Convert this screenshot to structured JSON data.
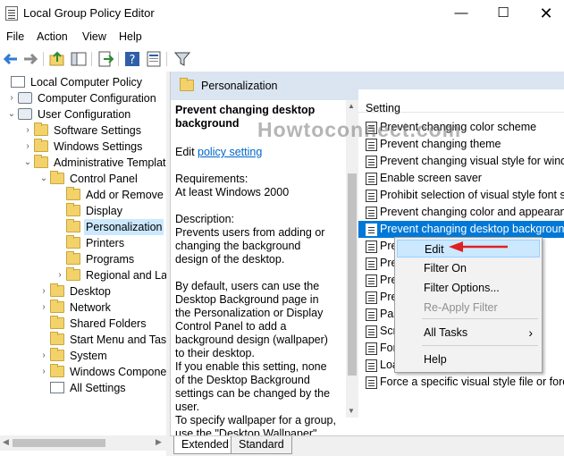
{
  "window": {
    "title": "Local Group Policy Editor",
    "min_glyph": "—",
    "max_glyph": "☐",
    "close_glyph": "✕"
  },
  "menu": [
    "File",
    "Action",
    "View",
    "Help"
  ],
  "tree": [
    {
      "label": "Local Computer Policy",
      "level": 0,
      "icon": "computer-icon",
      "twisty": ""
    },
    {
      "label": "Computer Configuration",
      "level": 1,
      "icon": "gear-icon",
      "twisty": "›"
    },
    {
      "label": "User Configuration",
      "level": 1,
      "icon": "gear-icon",
      "twisty": "⌄"
    },
    {
      "label": "Software Settings",
      "level": 2,
      "icon": "folder-icon",
      "twisty": "›"
    },
    {
      "label": "Windows Settings",
      "level": 2,
      "icon": "folder-icon",
      "twisty": "›"
    },
    {
      "label": "Administrative Templat",
      "level": 2,
      "icon": "folder-icon",
      "twisty": "⌄"
    },
    {
      "label": "Control Panel",
      "level": 3,
      "icon": "folder-icon",
      "twisty": "⌄"
    },
    {
      "label": "Add or Remove",
      "level": 4,
      "icon": "folder-icon",
      "twisty": ""
    },
    {
      "label": "Display",
      "level": 4,
      "icon": "folder-icon",
      "twisty": ""
    },
    {
      "label": "Personalization",
      "level": 4,
      "icon": "folder-icon",
      "twisty": "",
      "selected": true
    },
    {
      "label": "Printers",
      "level": 4,
      "icon": "folder-icon",
      "twisty": ""
    },
    {
      "label": "Programs",
      "level": 4,
      "icon": "folder-icon",
      "twisty": ""
    },
    {
      "label": "Regional and La",
      "level": 4,
      "icon": "folder-icon",
      "twisty": "›"
    },
    {
      "label": "Desktop",
      "level": 3,
      "icon": "folder-icon",
      "twisty": "›"
    },
    {
      "label": "Network",
      "level": 3,
      "icon": "folder-icon",
      "twisty": "›"
    },
    {
      "label": "Shared Folders",
      "level": 3,
      "icon": "folder-icon",
      "twisty": ""
    },
    {
      "label": "Start Menu and Tasl",
      "level": 3,
      "icon": "folder-icon",
      "twisty": ""
    },
    {
      "label": "System",
      "level": 3,
      "icon": "folder-icon",
      "twisty": "›"
    },
    {
      "label": "Windows Compone",
      "level": 3,
      "icon": "folder-icon",
      "twisty": "›"
    },
    {
      "label": "All Settings",
      "level": 3,
      "icon": "settings-doc-icon",
      "twisty": ""
    }
  ],
  "header": {
    "title": "Personalization"
  },
  "description": {
    "title": "Prevent changing desktop background",
    "edit_prefix": "Edit",
    "edit_link": "policy setting",
    "requirements_label": "Requirements:",
    "requirements_value": "At least Windows 2000",
    "description_label": "Description:",
    "p1": "Prevents users from adding or changing the background design of the desktop.",
    "p2": "By default, users can use the Desktop Background page in the Personalization or Display Control Panel to add a background design (wallpaper) to their desktop.",
    "p3": "If you enable this setting, none of the Desktop Background settings can be changed by the user.",
    "p4": "To specify wallpaper for a group, use the \"Desktop Wallpaper\""
  },
  "list": {
    "column_header": "Setting",
    "rows": [
      "Prevent changing color scheme",
      "Prevent changing theme",
      "Prevent changing visual style for windo",
      "Enable screen saver",
      "Prohibit selection of visual style font siz",
      "Prevent changing color and appearance",
      "Prevent changing desktop background",
      "Pre",
      "Pre",
      "Pre",
      "Pre",
      "Pas",
      "Scr",
      "For",
      "Loa",
      "Force a specific visual style file or force"
    ],
    "selected_index": 6
  },
  "context_menu": {
    "items": [
      {
        "label": "Edit",
        "state": "highlighted"
      },
      {
        "label": "Filter On",
        "state": "normal"
      },
      {
        "label": "Filter Options...",
        "state": "normal"
      },
      {
        "label": "Re-Apply Filter",
        "state": "disabled"
      },
      {
        "label": "All Tasks",
        "state": "submenu"
      },
      {
        "label": "Help",
        "state": "normal"
      }
    ]
  },
  "tabs": [
    "Extended",
    "Standard"
  ],
  "watermark": "Howtoconnect.com",
  "colors": {
    "selection": "#0078d7",
    "header_band": "#dbe5f1",
    "arrow": "#e0201f",
    "link": "#0066cc"
  }
}
